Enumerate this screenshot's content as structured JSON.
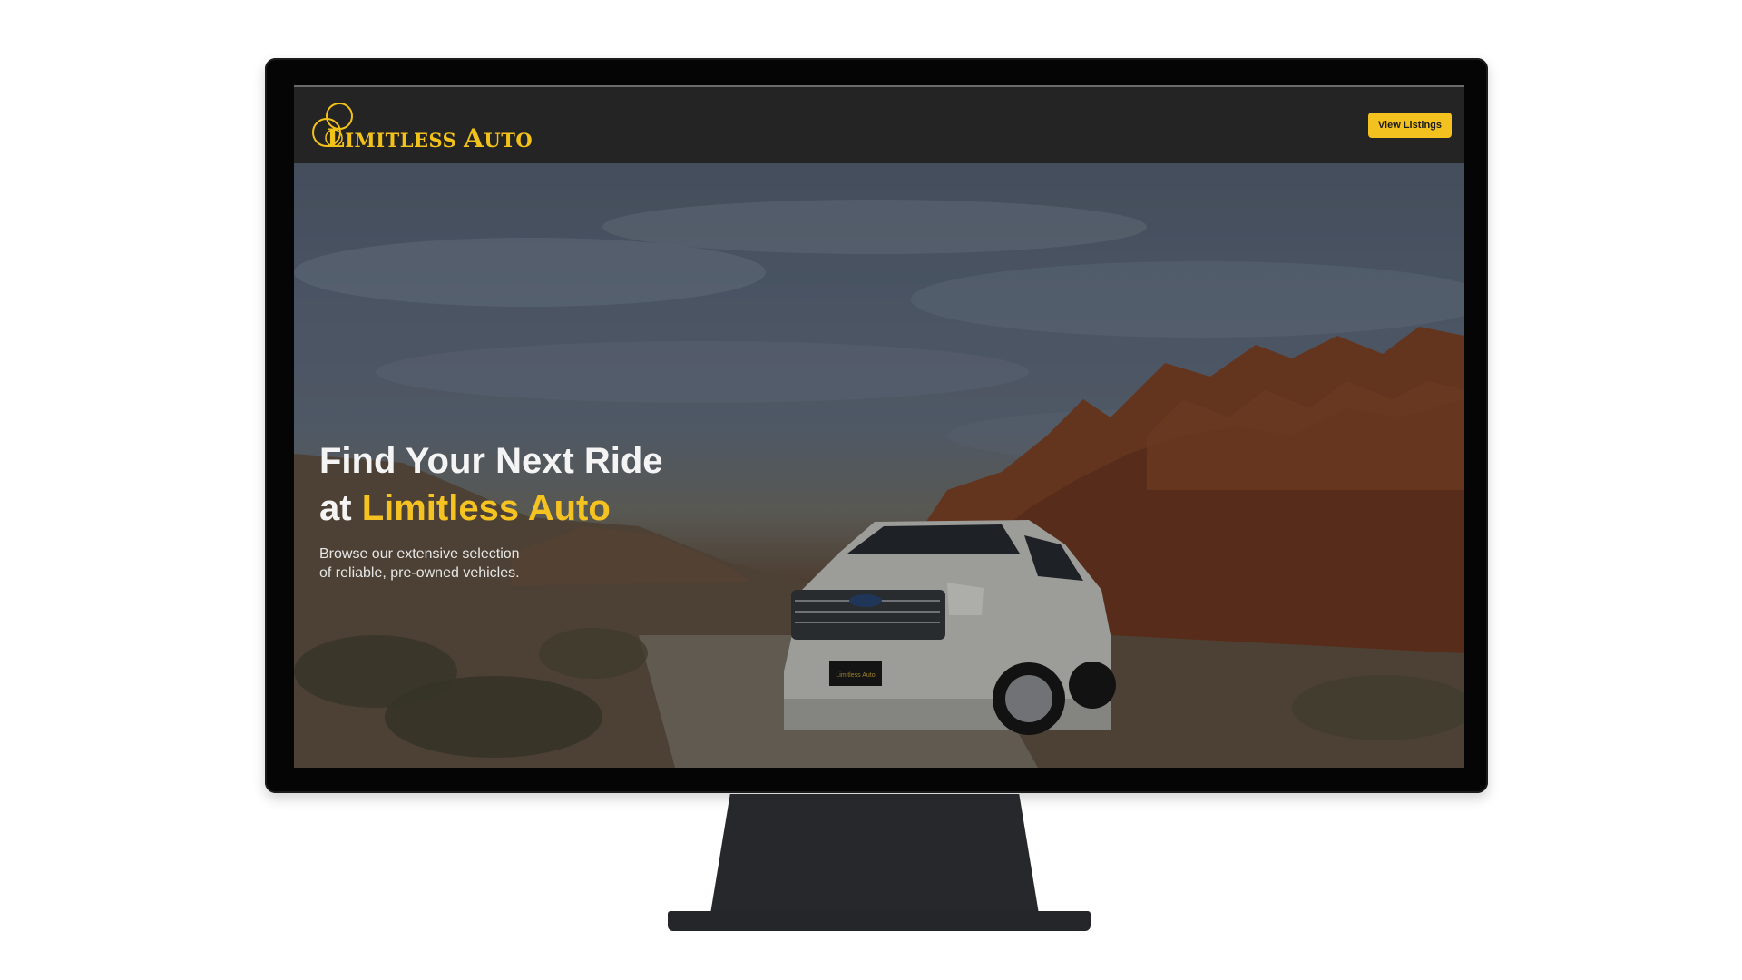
{
  "brand": {
    "logo_first_cap": "L",
    "logo_first_rest": "IMITLESS",
    "logo_second_cap": "A",
    "logo_second_rest": "UTO",
    "accent_color": "#f5c321"
  },
  "nav": {
    "cta_label": "View Listings"
  },
  "hero": {
    "title_line1": "Find Your Next Ride",
    "title_line2_prefix": "at ",
    "title_line2_accent": "Limitless Auto",
    "subtitle_line1": "Browse our extensive selection",
    "subtitle_line2": "of reliable, pre-owned vehicles.",
    "plate_text": "Limitless Auto"
  },
  "colors": {
    "navbar_bg": "#242424",
    "monitor_bezel": "#050505",
    "stand": "#27282c",
    "button_bg": "#f4c21f"
  }
}
